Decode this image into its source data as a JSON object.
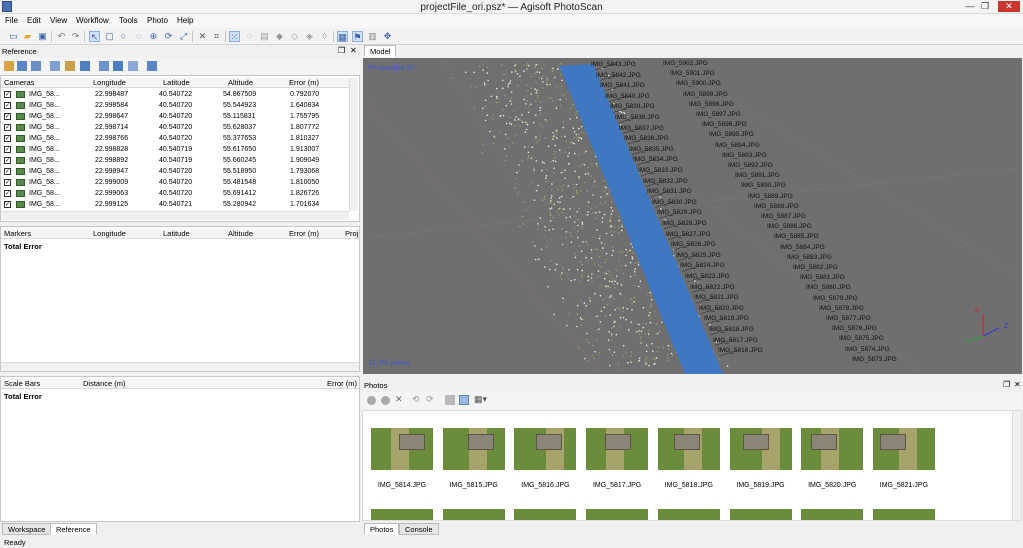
{
  "window": {
    "title": "projectFile_ori.psz* — Agisoft PhotoScan"
  },
  "menu": [
    "File",
    "Edit",
    "View",
    "Workflow",
    "Tools",
    "Photo",
    "Help"
  ],
  "reference": {
    "title": "Reference",
    "cameras_header": [
      "Cameras",
      "Longitude",
      "Latitude",
      "Altitude",
      "Error (m)"
    ],
    "cameras": [
      {
        "name": "IMG_58...",
        "lon": "22.998487",
        "lat": "40.540722",
        "alt": "54.867509",
        "err": "0.792070"
      },
      {
        "name": "IMG_58...",
        "lon": "22.998584",
        "lat": "40.540720",
        "alt": "55.544923",
        "err": "1.640834"
      },
      {
        "name": "IMG_58...",
        "lon": "22.998647",
        "lat": "40.540720",
        "alt": "55.115831",
        "err": "1.755795"
      },
      {
        "name": "IMG_58...",
        "lon": "22.998714",
        "lat": "40.540720",
        "alt": "55.628037",
        "err": "1.807772"
      },
      {
        "name": "IMG_58...",
        "lon": "22.998766",
        "lat": "40.540720",
        "alt": "55.377653",
        "err": "1.810327"
      },
      {
        "name": "IMG_58...",
        "lon": "22.998828",
        "lat": "40.540719",
        "alt": "55.617650",
        "err": "1.913007"
      },
      {
        "name": "IMG_58...",
        "lon": "22.998892",
        "lat": "40.540719",
        "alt": "55.660245",
        "err": "1.909049"
      },
      {
        "name": "IMG_58...",
        "lon": "22.998947",
        "lat": "40.540720",
        "alt": "55.518950",
        "err": "1.793068"
      },
      {
        "name": "IMG_58...",
        "lon": "22.999009",
        "lat": "40.540720",
        "alt": "55.481548",
        "err": "1.810050"
      },
      {
        "name": "IMG_58...",
        "lon": "22.999063",
        "lat": "40.540720",
        "alt": "55.691412",
        "err": "1.826726"
      },
      {
        "name": "IMG_58...",
        "lon": "22.999125",
        "lat": "40.540721",
        "alt": "55.280942",
        "err": "1.701634"
      }
    ],
    "markers_header": [
      "Markers",
      "Longitude",
      "Latitude",
      "Altitude",
      "Error (m)",
      "Proj"
    ],
    "markers_total": "Total Error",
    "scalebars_header": [
      "Scale Bars",
      "Distance (m)",
      "Error (m)"
    ],
    "scalebars_total": "Total Error"
  },
  "model": {
    "tab": "Model",
    "perspective": "Perspective 30°",
    "points": "11,781 points",
    "axes": [
      "X",
      "Y",
      "Z"
    ],
    "labels": [
      "IMG_5843.JPG",
      "IMG_5842.JPG",
      "IMG_5841.JPG",
      "IMG_5840.JPG",
      "IMG_5839.JPG",
      "IMG_5838.JPG",
      "IMG_5837.JPG",
      "IMG_5836.JPG",
      "IMG_5835.JPG",
      "IMG_5834.JPG",
      "IMG_5833.JPG",
      "IMG_5832.JPG",
      "IMG_5831.JPG",
      "IMG_5830.JPG",
      "IMG_5829.JPG",
      "IMG_5828.JPG",
      "IMG_5827.JPG",
      "IMG_5826.JPG",
      "IMG_5825.JPG",
      "IMG_5824.JPG",
      "IMG_5823.JPG",
      "IMG_5822.JPG",
      "IMG_5821.JPG",
      "IMG_5820.JPG",
      "IMG_5819.JPG",
      "IMG_5818.JPG",
      "IMG_5817.JPG",
      "IMG_5816.JPG",
      "IMG_5902.JPG",
      "IMG_5901.JPG",
      "IMG_5900.JPG",
      "IMG_5899.JPG",
      "IMG_5898.JPG",
      "IMG_5897.JPG",
      "IMG_5896.JPG",
      "IMG_5895.JPG",
      "IMG_5894.JPG",
      "IMG_5893.JPG",
      "IMG_5892.JPG",
      "IMG_5891.JPG",
      "IMG_5890.JPG",
      "IMG_5889.JPG",
      "IMG_5888.JPG",
      "IMG_5887.JPG",
      "IMG_5886.JPG",
      "IMG_5885.JPG",
      "IMG_5884.JPG",
      "IMG_5883.JPG",
      "IMG_5882.JPG",
      "IMG_5881.JPG",
      "IMG_5880.JPG",
      "IMG_5879.JPG",
      "IMG_5878.JPG",
      "IMG_5877.JPG",
      "IMG_5876.JPG",
      "IMG_5875.JPG",
      "IMG_5874.JPG",
      "IMG_5873.JPG"
    ]
  },
  "photos": {
    "title": "Photos",
    "items": [
      "IMG_5814.JPG",
      "IMG_5815.JPG",
      "IMG_5816.JPG",
      "IMG_5817.JPG",
      "IMG_5818.JPG",
      "IMG_5819.JPG",
      "IMG_5820.JPG",
      "IMG_5821.JPG"
    ]
  },
  "bottom_tabs_left": [
    "Workspace",
    "Reference"
  ],
  "bottom_tabs_right": [
    "Photos",
    "Console"
  ],
  "status": "Ready",
  "colors": {
    "accent": "#3c78c8",
    "viewport": "#6e6e6e",
    "strip": "#3f78c2"
  }
}
